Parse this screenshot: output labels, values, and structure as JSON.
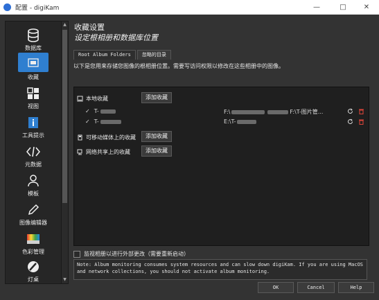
{
  "window": {
    "title": "配置 - digiKam",
    "min_icon": "minimize-icon",
    "max_icon": "maximize-icon",
    "close_icon": "close-icon"
  },
  "sidebar": {
    "items": [
      {
        "label": "数据库",
        "icon": "database-icon"
      },
      {
        "label": "收藏",
        "icon": "collection-icon"
      },
      {
        "label": "视图",
        "icon": "grid-view-icon"
      },
      {
        "label": "工具提示",
        "icon": "tooltip-icon"
      },
      {
        "label": "元数据",
        "icon": "code-icon"
      },
      {
        "label": "模板",
        "icon": "person-icon"
      },
      {
        "label": "图像编辑器",
        "icon": "pencil-icon"
      },
      {
        "label": "色彩管理",
        "icon": "color-management-icon"
      },
      {
        "label": "灯桌",
        "icon": "light-table-icon"
      }
    ],
    "active_index": 1
  },
  "header": {
    "title": "收藏设置",
    "subtitle": "设定根相册和数据库位置"
  },
  "tabs": [
    {
      "label": "Root Album Folders",
      "active": true
    },
    {
      "label": "忽略的目录",
      "active": false
    }
  ],
  "description": "以下是您用来存储您图像的根相册位置。需要写访问权限以修改在这些相册中的图像。",
  "collections": {
    "local": {
      "label": "本地收藏",
      "add_label": "添加收藏"
    },
    "local_items": [
      {
        "name": "T-",
        "path_prefix": "F:\\",
        "path_suffix": "F:\\T-图片管..."
      },
      {
        "name": "T-",
        "path_prefix": "E:\\T-",
        "path_suffix": ""
      }
    ],
    "removable": {
      "label": "可移动媒体上的收藏",
      "add_label": "添加收藏"
    },
    "network": {
      "label": "网络共享上的收藏",
      "add_label": "添加收藏"
    }
  },
  "monitor_checkbox": {
    "label": "监视相册以进行外部更改（需要重新启动）",
    "checked": false
  },
  "note": "Note: Album monitoring consumes system resources and can slow down digiKam. If you are using MacOS and network collections, you should not activate album monitoring.",
  "footer": {
    "ok": "OK",
    "cancel": "Cancel",
    "help": "Help"
  },
  "colors": {
    "accent": "#2f7fd0",
    "background": "#333333",
    "panel": "#1f1f1f",
    "delete": "#e0453a"
  }
}
